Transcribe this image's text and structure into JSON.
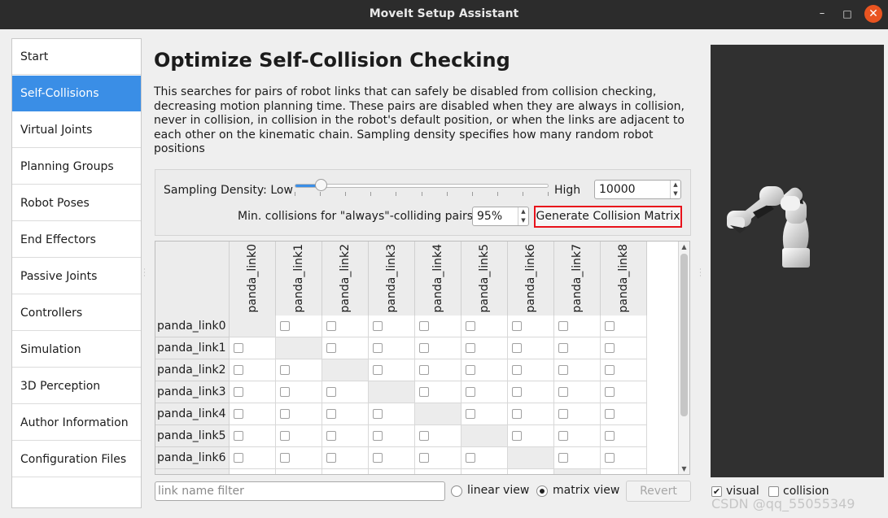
{
  "window": {
    "title": "MoveIt Setup Assistant",
    "min_glyph": "–",
    "max_glyph": "□",
    "close_glyph": "✕"
  },
  "nav": {
    "items": [
      {
        "label": "Start",
        "active": false
      },
      {
        "label": "Self-Collisions",
        "active": true
      },
      {
        "label": "Virtual Joints",
        "active": false
      },
      {
        "label": "Planning Groups",
        "active": false
      },
      {
        "label": "Robot Poses",
        "active": false
      },
      {
        "label": "End Effectors",
        "active": false
      },
      {
        "label": "Passive Joints",
        "active": false
      },
      {
        "label": "Controllers",
        "active": false
      },
      {
        "label": "Simulation",
        "active": false
      },
      {
        "label": "3D Perception",
        "active": false
      },
      {
        "label": "Author Information",
        "active": false
      },
      {
        "label": "Configuration Files",
        "active": false
      }
    ]
  },
  "page": {
    "heading": "Optimize Self-Collision Checking",
    "description": "This searches for pairs of robot links that can safely be disabled from collision checking, decreasing motion planning time. These pairs are disabled when they are always in collision, never in collision, in collision in the robot's default position, or when the links are adjacent to each other on the kinematic chain. Sampling density specifies how many random robot positions"
  },
  "sampling": {
    "label": "Sampling Density: Low",
    "high_label": "High",
    "slider_level": 0.09,
    "density_value": "10000",
    "min_collisions_label": "Min. collisions for \"always\"-colliding pairs:",
    "min_collisions_value": "95%",
    "generate_label": "Generate Collision Matrix"
  },
  "matrix": {
    "columns": [
      "panda_link0",
      "panda_link1",
      "panda_link2",
      "panda_link3",
      "panda_link4",
      "panda_link5",
      "panda_link6",
      "panda_link7",
      "panda_link8"
    ],
    "rows": [
      "panda_link0",
      "panda_link1",
      "panda_link2",
      "panda_link3",
      "panda_link4",
      "panda_link5",
      "panda_link6"
    ]
  },
  "footer": {
    "filter_placeholder": "link name filter",
    "linear_view_label": "linear view",
    "matrix_view_label": "matrix view",
    "selected_view": "matrix view",
    "revert_label": "Revert"
  },
  "viewer": {
    "visual_label": "visual",
    "visual_checked": true,
    "collision_label": "collision",
    "collision_checked": false
  },
  "watermark": "CSDN @qq_55055349",
  "colors": {
    "accent": "#3a8ee6",
    "highlight_border": "#e8121b",
    "titlebar": "#2c2c2c",
    "close_button": "#e95420",
    "viewer_bg": "#303030"
  }
}
